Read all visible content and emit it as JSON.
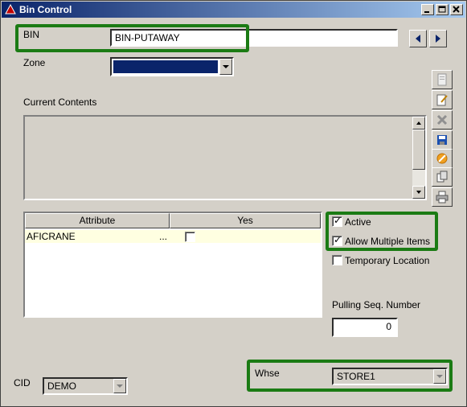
{
  "window": {
    "title": "Bin Control",
    "controls": [
      "_",
      "□",
      "×"
    ]
  },
  "bin": {
    "label": "BIN",
    "value": "BIN-PUTAWAY"
  },
  "zone": {
    "label": "Zone",
    "value": ""
  },
  "contents": {
    "label": "Current Contents"
  },
  "toolbar": {
    "icons": [
      "new-icon",
      "edit-icon",
      "delete-icon",
      "save-icon",
      "cancel-icon",
      "copy-icon",
      "print-icon"
    ]
  },
  "attributes": {
    "columns": [
      "Attribute",
      "Yes"
    ],
    "rows": [
      {
        "attribute": "AFICRANE",
        "ellipsis": "...",
        "yes": false
      }
    ]
  },
  "options": {
    "active": {
      "label": "Active",
      "checked": true
    },
    "allow_multiple": {
      "label": "Allow Multiple Items",
      "checked": true
    },
    "temporary": {
      "label": "Temporary Location",
      "checked": false
    }
  },
  "pulling": {
    "label": "Pulling Seq. Number",
    "value": "0"
  },
  "whse": {
    "label": "Whse",
    "value": "STORE1"
  },
  "cid": {
    "label": "CID",
    "value": "DEMO"
  },
  "colors": {
    "highlight": "#1b7b14",
    "zone_fill": "#0a246a",
    "row_highlight": "#ffffe1"
  }
}
